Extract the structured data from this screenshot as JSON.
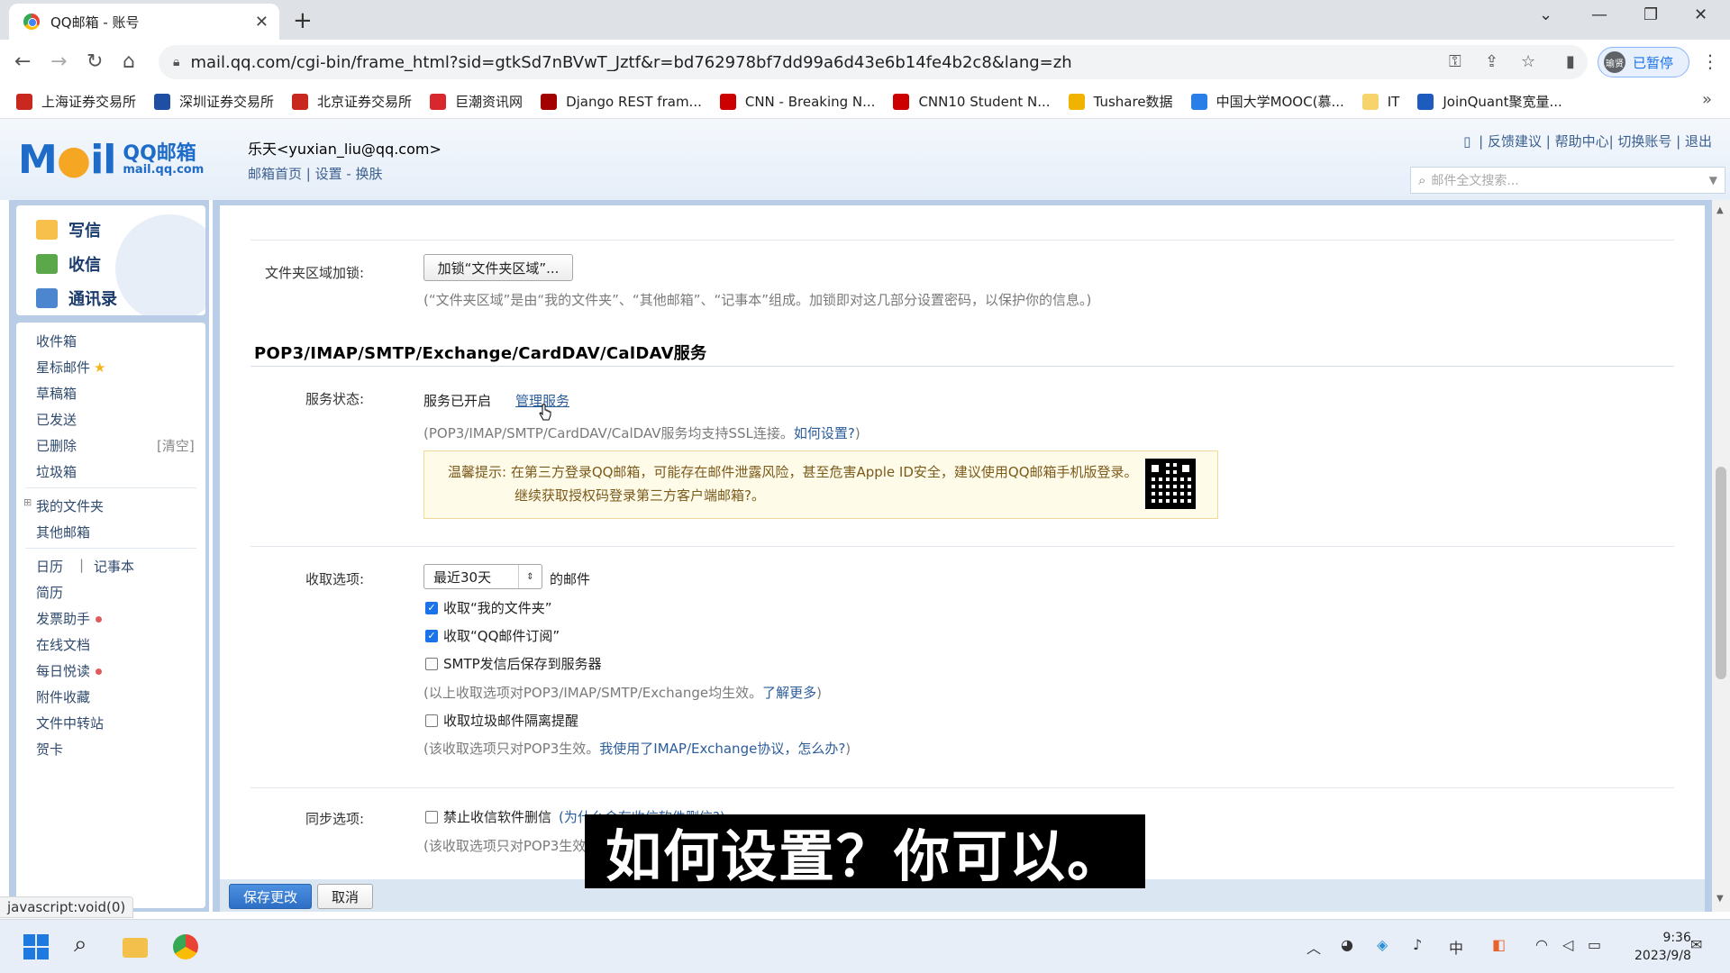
{
  "browser": {
    "tab_title": "QQ邮箱 - 账号",
    "tab_close": "✕",
    "new_tab": "+",
    "url": "mail.qq.com/cgi-bin/frame_html?sid=gtkSd7nBVwT_Jztf&r=bd762978bf7dd99a6d43e6b14fe4b2c8&lang=zh",
    "profile_label": "已暂停",
    "profile_avatar": "瑜贤",
    "bookmarks": [
      {
        "label": "上海证券交易所",
        "color": "#c8281e"
      },
      {
        "label": "深圳证券交易所",
        "color": "#1f4fa3"
      },
      {
        "label": "北京证券交易所",
        "color": "#c8281e"
      },
      {
        "label": "巨潮资讯网",
        "color": "#d9272e"
      },
      {
        "label": "Django REST fram...",
        "color": "#a30000"
      },
      {
        "label": "CNN - Breaking N...",
        "color": "#cc0000"
      },
      {
        "label": "CNN10 Student N...",
        "color": "#cc0000"
      },
      {
        "label": "Tushare数据",
        "color": "#f0b400"
      },
      {
        "label": "中国大学MOOC(慕...",
        "color": "#2a7ee8"
      },
      {
        "label": "IT",
        "color": "#f7d46b"
      },
      {
        "label": "JoinQuant聚宽量...",
        "color": "#1d5bbf"
      }
    ],
    "status_text": "javascript:void(0)"
  },
  "mail_header": {
    "logo_main": "M",
    "logo_o": "●",
    "logo_rest": "il",
    "logo_cn": "QQ邮箱",
    "logo_domain": "mail.qq.com",
    "user_name": "乐天<yuxian_liu@qq.com>",
    "user_links": "邮箱首页 | 设置 - 换肤",
    "top_links": "| 反馈建议 | 帮助中心| 切换账号 | 退出",
    "search_placeholder": "邮件全文搜索..."
  },
  "sidebar": {
    "compose": "写信",
    "receive": "收信",
    "contacts": "通讯录",
    "items": {
      "inbox": "收件箱",
      "starred": "星标邮件",
      "drafts": "草稿箱",
      "sent": "已发送",
      "deleted": "已删除",
      "clear": "[清空]",
      "spam": "垃圾箱",
      "my_folders": "我的文件夹",
      "other_mail": "其他邮箱",
      "calendar": "日历",
      "sep": "|",
      "notes": "记事本",
      "resume": "简历",
      "invoice": "发票助手",
      "docs": "在线文档",
      "daily": "每日悦读",
      "attachments": "附件收藏",
      "transfer": "文件中转站",
      "cards": "贺卡"
    }
  },
  "content": {
    "folder_lock_label": "文件夹区域加锁:",
    "folder_lock_button": "加锁“文件夹区域”...",
    "folder_lock_hint": "(“文件夹区域”是由“我的文件夹”、“其他邮箱”、“记事本”组成。加锁即对这几部分设置密码，以保护你的信息。)",
    "section_title": "POP3/IMAP/SMTP/Exchange/CardDAV/CalDAV服务",
    "service_status_label": "服务状态:",
    "service_status_value": "服务已开启",
    "manage_service_link": "管理服务",
    "ssl_hint_pre": "(POP3/IMAP/SMTP/CardDAV/CalDAV服务均支持SSL连接。",
    "ssl_hint_link": "如何设置?",
    "ssl_hint_post": ")",
    "warn_line1": "温馨提示: 在第三方登录QQ邮箱，可能存在邮件泄露风险，甚至危害Apple ID安全，建议使用QQ邮箱手机版登录。",
    "warn_line2": "继续获取授权码登录第三方客户端邮箱?。",
    "receive_label": "收取选项:",
    "receive_select": "最近30天",
    "receive_suffix": "的邮件",
    "cb1": "收取“我的文件夹”",
    "cb2": "收取“QQ邮件订阅”",
    "cb3": "SMTP发信后保存到服务器",
    "receive_hint_pre": "(以上收取选项对POP3/IMAP/SMTP/Exchange均生效。",
    "receive_hint_link": "了解更多",
    "receive_hint_post": ")",
    "cb4": "收取垃圾邮件隔离提醒",
    "pop3_hint_pre": "(该收取选项只对POP3生效。",
    "pop3_hint_link": "我使用了IMAP/Exchange协议，怎么办?",
    "pop3_hint_post": ")",
    "sync_label": "同步选项:",
    "cb5": "禁止收信软件删信",
    "cb5_hint": "(为什么会有收信软件删信?)",
    "sync_hint": "(该收取选项只对POP3生效",
    "save_button": "保存更改",
    "cancel_button": "取消"
  },
  "checkboxes": {
    "cb1": true,
    "cb2": true,
    "cb3": false,
    "cb4": false,
    "cb5": false
  },
  "subtitle": "如何设置？你可以。",
  "taskbar": {
    "time": "9:36",
    "date": "2023/9/8",
    "ime": "中"
  },
  "colors": {
    "accent": "#2c5d9b",
    "save": "#2d6fc4",
    "warn_bg": "#fffbe9"
  }
}
